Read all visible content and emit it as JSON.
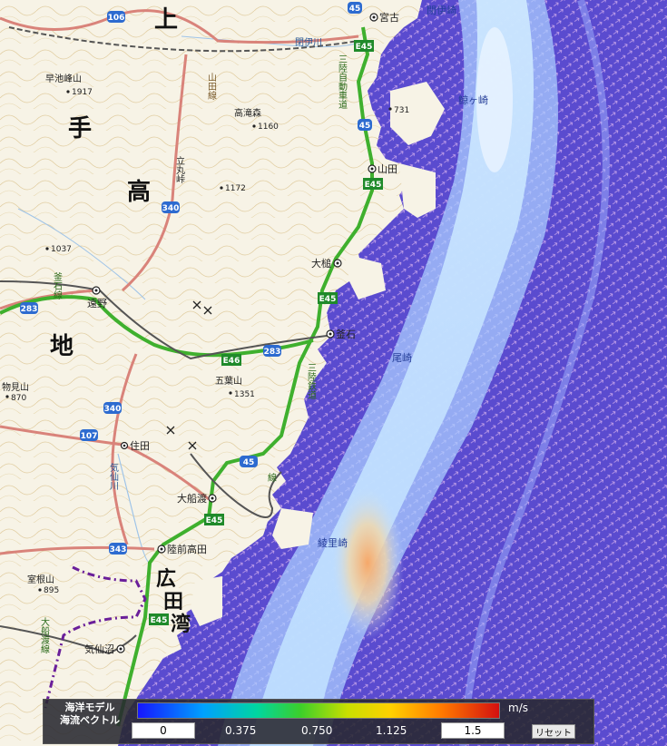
{
  "map": {
    "area_labels": [
      "上",
      "手",
      "高",
      "地"
    ],
    "bay_label": [
      "広",
      "田",
      "湾"
    ],
    "peaks": [
      {
        "name": "早池峰山",
        "elev": "1917"
      },
      {
        "name": "高滝森",
        "elev": "1160"
      },
      {
        "name": "",
        "elev": "1172"
      },
      {
        "name": "",
        "elev": "1037"
      },
      {
        "name": "五葉山",
        "elev": "1351"
      },
      {
        "name": "物見山",
        "elev": "870"
      },
      {
        "name": "室根山",
        "elev": "895"
      },
      {
        "name": "",
        "elev": "731"
      }
    ],
    "cities": [
      "宮古",
      "山田",
      "大槌",
      "遠野",
      "釜石",
      "住田",
      "大船渡",
      "陸前高田",
      "気仙沼"
    ],
    "pass": "立丸峠",
    "capes": [
      "閉伊崎",
      "鯨ヶ崎",
      "尾崎",
      "綾里崎"
    ],
    "rail_lines": [
      "閉伊川",
      "山田線",
      "三陸自動車道",
      "三陸鉄道",
      "釜石線",
      "気仙川",
      "大船渡線",
      "線"
    ],
    "route_shields": [
      "106",
      "340",
      "283",
      "283",
      "340",
      "107",
      "45",
      "343",
      "45",
      "45"
    ],
    "expressway_shields": [
      "E45",
      "E45",
      "E45",
      "E46",
      "E45",
      "E45"
    ],
    "colors": {
      "sea": "#5848d0",
      "current_fast": "#c8e6ff",
      "current_max": "#f4b07a",
      "land": "#f5f1e4",
      "contour": "#c9a860",
      "national_road": "#d9837a",
      "expressway": "#3fb02e",
      "railway": "#555555"
    }
  },
  "legend": {
    "title_line1": "海洋モデル",
    "title_line2": "海流ベクトル",
    "unit": "m/s",
    "min_value": "0",
    "max_value": "1.5",
    "ticks": [
      "0.375",
      "0.750",
      "1.125"
    ],
    "reset_label": "リセット"
  }
}
